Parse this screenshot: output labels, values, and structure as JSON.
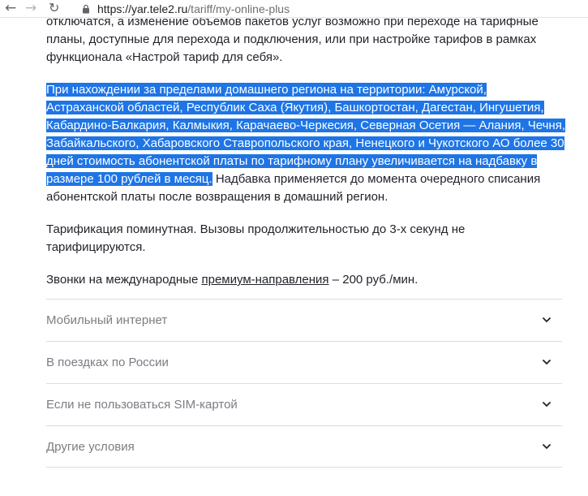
{
  "browser": {
    "back_icon": "←",
    "forward_icon": "→",
    "reload_icon": "↻",
    "url_host": "https://yar.tele2.ru",
    "url_path": "/tariff/my-online-plus"
  },
  "content": {
    "para_top": "отключатся, а изменение объемов пакетов услуг возможно при переходе на тарифные планы, доступные для перехода и подключения, или при настройке тарифов в рамках функционала «Настрой тариф для себя».",
    "roaming_highlighted": "При нахождении за пределами домашнего региона на территории: Амурской, Астраханской областей, Республик Саха (Якутия), Башкортостан, Дагестан, Ингушетия, Кабардино-Балкария, Калмыкия, Карачаево-Черкесия, Северная Осетия — Алания, Чечня, Забайкальского, Хабаровского Ставропольского края, Ненецкого и Чукотского АО более 30 дней стоимость абонентской платы по тарифному плану увеличивается на надбавку в размере 100 рублей в месяц.",
    "roaming_rest": " Надбавка применяется до момента очередного списания абонентской платы после возвращения в домашний регион.",
    "billing": "Тарификация поминутная. Вызовы продолжительностью до 3-х секунд не тарифицируются.",
    "intl_prefix": "Звонки на международные ",
    "intl_link": "премиум-направления",
    "intl_suffix": " – 200 руб./мин."
  },
  "accordion": {
    "items": [
      {
        "label": "Мобильный интернет"
      },
      {
        "label": "В поездках по России"
      },
      {
        "label": "Если не пользоваться SIM-картой"
      },
      {
        "label": "Другие условия"
      }
    ]
  },
  "colors": {
    "selection": "#1e75e6",
    "text": "#1f2229",
    "muted": "#7a7d83",
    "divider": "#dcdcdc"
  }
}
